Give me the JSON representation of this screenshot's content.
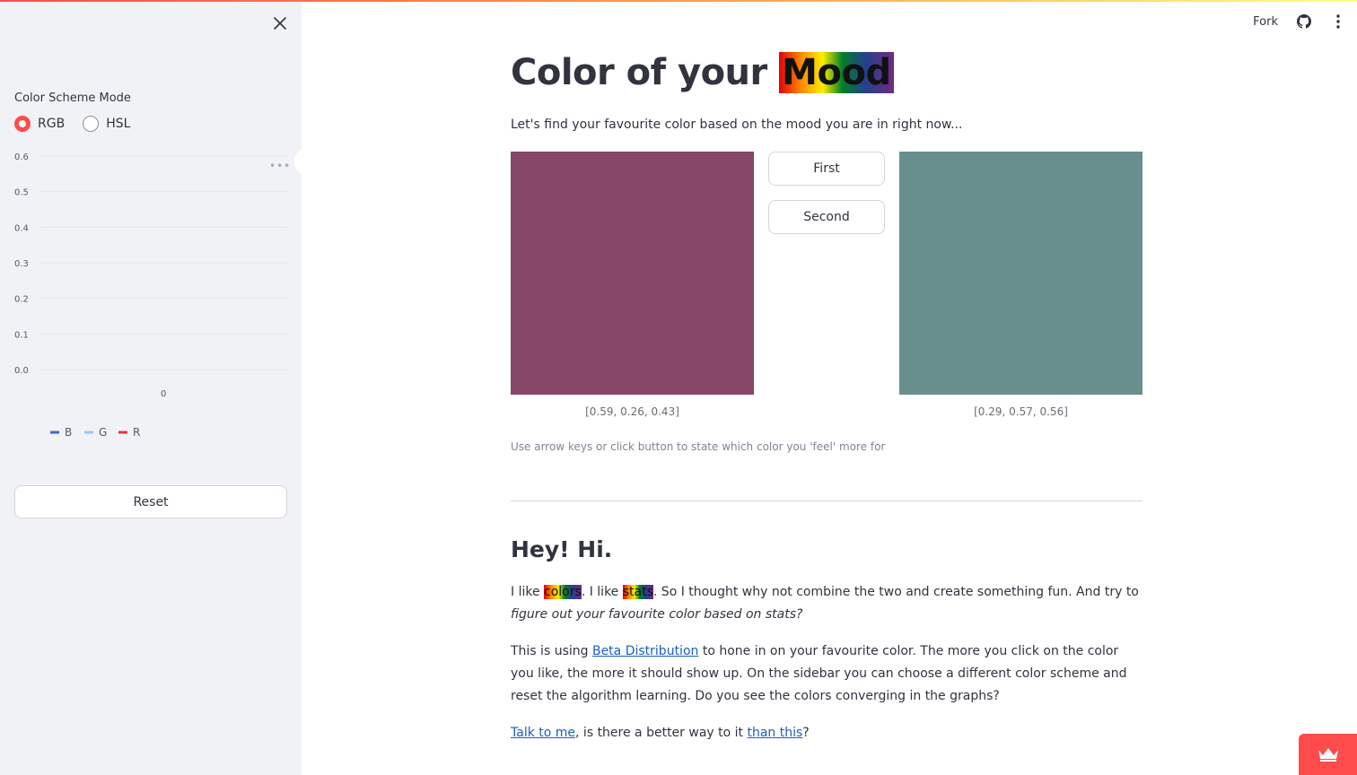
{
  "sidebar": {
    "color_scheme_label": "Color Scheme Mode",
    "radio_options": [
      {
        "label": "RGB",
        "selected": true
      },
      {
        "label": "HSL",
        "selected": false
      }
    ],
    "reset_label": "Reset"
  },
  "header": {
    "fork_label": "Fork",
    "icons": [
      "close-icon",
      "github-icon",
      "kebab-menu-icon"
    ]
  },
  "main": {
    "title_prefix": "Color of your ",
    "title_highlight": "Mood",
    "subtitle": "Let's find your favourite color based on the mood you are in right now...",
    "first_button": "First",
    "second_button": "Second",
    "swatch_left": {
      "color": "#854668",
      "caption": "[0.59, 0.26, 0.43]"
    },
    "swatch_right": {
      "color": "#688F8D",
      "caption": "[0.29, 0.57, 0.56]"
    },
    "hint": "Use arrow keys or click button to state which color you 'feel' more for",
    "heading": "Hey! Hi.",
    "para1": {
      "t1": "I like ",
      "hl1": "colors",
      "t2": ". I like ",
      "hl2": "stats",
      "t3": ". So I thought why not combine the two and create something fun. And try to ",
      "em": "figure out your favourite color based on stats?"
    },
    "para2": {
      "t1": "This is using ",
      "link": "Beta Distribution",
      "t2": " to hone in on your favourite color. The more you click on the color you like, the more it should show up. On the sidebar you can choose a different color scheme and reset the algorithm learning. Do you see the colors converging in the graphs?"
    },
    "para3": {
      "link1": "Talk to me",
      "t1": ", is there a better way to it ",
      "link2": "than this",
      "t2": "?"
    }
  },
  "chart_data": {
    "type": "line",
    "y_ticks": [
      "0.6",
      "0.5",
      "0.4",
      "0.3",
      "0.2",
      "0.1",
      "0.0"
    ],
    "x_ticks": [
      "0"
    ],
    "ylim": [
      0,
      0.6
    ],
    "grid": true,
    "legend_position": "bottom",
    "series": [
      {
        "name": "B",
        "color": "#3d6ac9",
        "values": []
      },
      {
        "name": "G",
        "color": "#9ac7f0",
        "values": []
      },
      {
        "name": "R",
        "color": "#e03b3b",
        "values": []
      }
    ]
  },
  "colors": {
    "accent": "#ff4b4b",
    "link": "#1c5ec0"
  }
}
